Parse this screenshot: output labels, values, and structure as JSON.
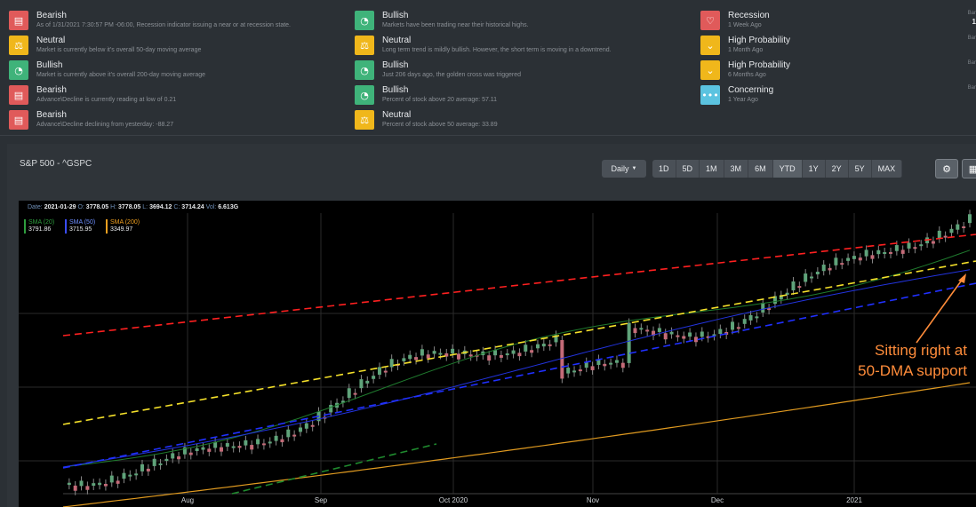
{
  "signals": {
    "col1": [
      {
        "title": "Bearish",
        "desc": "As of 1/31/2021 7:30:57 PM -06:00, Recession indicator issuing a near or at recession state.",
        "icon": "chat-icon",
        "color": "red"
      },
      {
        "title": "Neutral",
        "desc": "Market is currently below it's overall 50-day moving average",
        "icon": "scale-icon",
        "color": "yel"
      },
      {
        "title": "Bullish",
        "desc": "Market is currently above it's overall 200-day moving average",
        "icon": "gauge-icon",
        "color": "grn"
      },
      {
        "title": "Bearish",
        "desc": "Advance\\Decline is currently reading at low of 0.21",
        "icon": "chat-icon",
        "color": "red"
      },
      {
        "title": "Bearish",
        "desc": "Advance\\Decline declining from yesterday: -88.27",
        "icon": "chat-icon",
        "color": "red"
      }
    ],
    "col2": [
      {
        "title": "Bullish",
        "desc": "Markets have been trading near their historical highs.",
        "icon": "gauge-icon",
        "color": "grn"
      },
      {
        "title": "Neutral",
        "desc": "Long term trend is mildly bullish. However, the short term is moving in a downtrend.",
        "icon": "scale-icon",
        "color": "yel"
      },
      {
        "title": "Bullish",
        "desc": "Just 206 days ago, the golden cross was triggered",
        "icon": "gauge-icon",
        "color": "grn"
      },
      {
        "title": "Bullish",
        "desc": "Percent of stock above 20 average: 57.11",
        "icon": "gauge-icon",
        "color": "grn"
      },
      {
        "title": "Neutral",
        "desc": "Percent of stock above 50 average: 33.89",
        "icon": "scale-icon",
        "color": "yel"
      }
    ],
    "col3": [
      {
        "title": "Recession",
        "desc": "1 Week Ago",
        "icon": "bubble-icon",
        "color": "red",
        "tag": "Bar",
        "val": "1"
      },
      {
        "title": "High Probability",
        "desc": "1 Month Ago",
        "icon": "chevron-down-icon",
        "color": "yel",
        "tag": "Bar",
        "val": ""
      },
      {
        "title": "High Probability",
        "desc": "6 Months Ago",
        "icon": "chevron-down-icon",
        "color": "yel",
        "tag": "Bar",
        "val": ""
      },
      {
        "title": "Concerning",
        "desc": "1 Year Ago",
        "icon": "dots-icon",
        "color": "blue",
        "tag": "Bar",
        "val": ""
      }
    ]
  },
  "panel": {
    "title": "S&P 500 - ^GSPC",
    "interval": "Daily",
    "ranges": [
      "1D",
      "5D",
      "1M",
      "3M",
      "6M",
      "YTD",
      "1Y",
      "2Y",
      "5Y",
      "MAX"
    ],
    "active_range": "YTD"
  },
  "chart": {
    "info": {
      "date_label": "Date:",
      "date": "2021-01-29",
      "o_label": "O:",
      "o": "3778.05",
      "h_label": "H:",
      "h": "3778.05",
      "l_label": "L:",
      "l": "3694.12",
      "c_label": "C:",
      "c": "3714.24",
      "vol_label": "Vol:",
      "vol": "6.613G"
    },
    "smas": [
      {
        "name": "SMA (20)",
        "value": "3791.86",
        "color": "#2e9e3e"
      },
      {
        "name": "SMA (50)",
        "value": "3715.95",
        "color": "#3a4dff"
      },
      {
        "name": "SMA (200)",
        "value": "3349.97",
        "color": "#f0a020"
      }
    ],
    "x_labels": [
      "Aug",
      "Sep",
      "Oct 2020",
      "Nov",
      "Dec",
      "2021"
    ],
    "annotation": [
      "Sitting right at",
      "50-DMA support"
    ]
  },
  "chart_data": {
    "type": "candlestick",
    "title": "S&P 500 - ^GSPC",
    "x_ticks": [
      "Aug",
      "Sep",
      "Oct 2020",
      "Nov",
      "Dec",
      "2021"
    ],
    "last_candle": {
      "date": "2021-01-29",
      "open": 3778.05,
      "high": 3778.05,
      "low": 3694.12,
      "close": 3714.24,
      "volume": "6.613G"
    },
    "series": [
      {
        "name": "SMA (20)",
        "last": 3791.86
      },
      {
        "name": "SMA (50)",
        "last": 3715.95
      },
      {
        "name": "SMA (200)",
        "last": 3349.97
      }
    ],
    "grid": true
  }
}
